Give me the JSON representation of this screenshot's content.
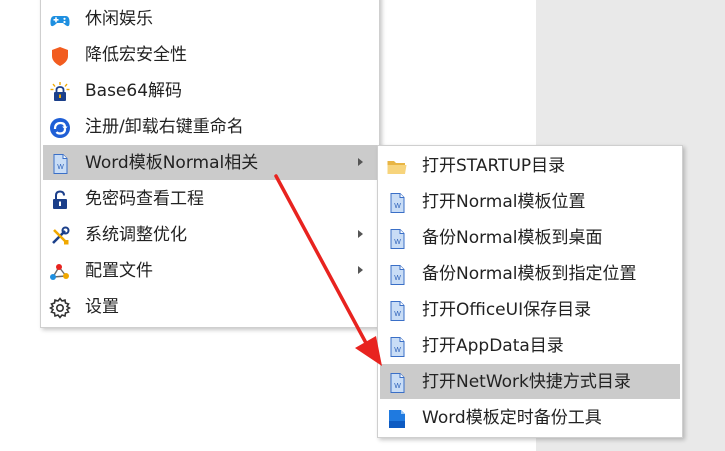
{
  "main_menu": {
    "items": [
      {
        "label": "休闲娱乐",
        "icon": "gamepad-icon"
      },
      {
        "label": "降低宏安全性",
        "icon": "shield-icon"
      },
      {
        "label": "Base64解码",
        "icon": "lock-icon"
      },
      {
        "label": "注册/卸载右键重命名",
        "icon": "refresh-icon"
      },
      {
        "label": "Word模板Normal相关",
        "icon": "word-doc-icon"
      },
      {
        "label": "免密码查看工程",
        "icon": "unlock-icon"
      },
      {
        "label": "系统调整优化",
        "icon": "tools-icon"
      },
      {
        "label": "配置文件",
        "icon": "network-icon"
      },
      {
        "label": "设置",
        "icon": "gear-icon"
      }
    ]
  },
  "sub_menu": {
    "items": [
      {
        "label": "打开STARTUP目录",
        "icon": "folder-icon"
      },
      {
        "label": "打开Normal模板位置",
        "icon": "word-doc-icon"
      },
      {
        "label": "备份Normal模板到桌面",
        "icon": "word-doc-icon"
      },
      {
        "label": "备份Normal模板到指定位置",
        "icon": "word-doc-icon"
      },
      {
        "label": "打开OfficeUI保存目录",
        "icon": "word-doc-icon"
      },
      {
        "label": "打开AppData目录",
        "icon": "word-doc-icon"
      },
      {
        "label": "打开NetWork快捷方式目录",
        "icon": "word-doc-icon"
      },
      {
        "label": "Word模板定时备份工具",
        "icon": "blue-file-icon"
      }
    ]
  },
  "colors": {
    "highlight": "#cbcbcb",
    "arrow_red": "#e8231f",
    "shield": "#f25c1f",
    "gamepad": "#1e8fe0"
  }
}
